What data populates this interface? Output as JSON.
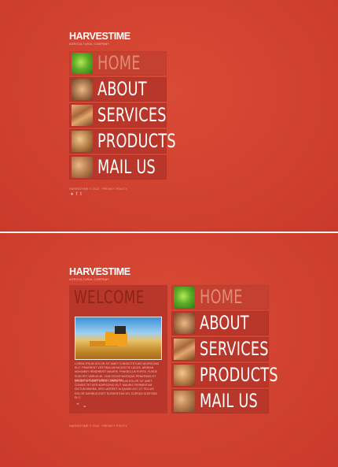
{
  "brand": {
    "name": "HARVESTIME",
    "tagline": "AGRICULTURAL COMPANY"
  },
  "menu": {
    "items": [
      {
        "label": "HOME",
        "thumb": "lettuce"
      },
      {
        "label": "ABOUT",
        "thumb": "potato"
      },
      {
        "label": "SERVICES",
        "thumb": "wheat"
      },
      {
        "label": "PRODUCTS",
        "thumb": "bread"
      },
      {
        "label": "MAIL US",
        "thumb": "nuts"
      }
    ],
    "active_index": 0
  },
  "footer": {
    "text": "HARVESTIME © 2012 · PRIVACY POLICY",
    "icons": "♦ f t"
  },
  "welcome": {
    "title": "WELCOME",
    "paragraph1": "LOREM IPSUM DOLOR SIT AMET CONSECTETUER ADIPISCING ELIT. PRAESENT VESTIBULUM MOLESTIE LACUS. AENEAN NONUMMY HENDRERIT MAURIS. PHASELLUS PORTA. FUSCE SUSCIPIT VARIUS MI. CUM SOCIIS NATOQUE PENATIBUS ET MAGNIS DIS PARTURIENT MONTES.",
    "paragraph2": "DONEC SIT AMET EROS. LOREM IPSUM DOLOR SIT AMET CONSECTETUER ADIPISCING ELIT. MAURIS FERMENTUM DICTUM MAGNA. SED LAOREET ALIQUAM LEO. UT TELLUS DOLOR DAPIBUS EGET ELEMENTUM VEL CURSUS ELEIFEND ELIT.",
    "nav_up": "⌃",
    "nav_down": "⌄"
  },
  "colors": {
    "background": "#cf3f2e",
    "panel": "#b8362a",
    "active_label": "#e38b73"
  }
}
